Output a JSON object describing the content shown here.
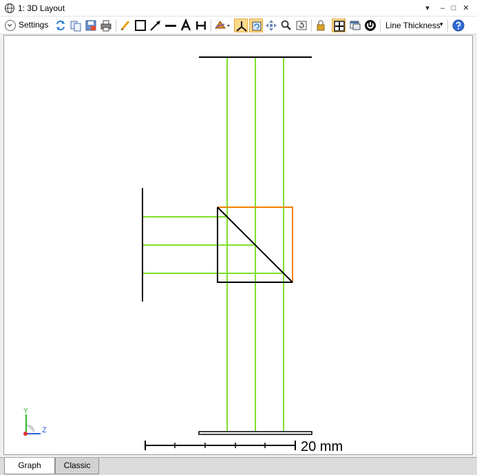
{
  "window": {
    "title": "1: 3D Layout",
    "controls": {
      "dropdown": "▾",
      "minimize": "–",
      "maximize": "□",
      "close": "✕"
    }
  },
  "toolbar": {
    "settings_label": "Settings",
    "line_thickness_label": "Line Thickness",
    "line_thickness_arrow": "▾",
    "icons": [
      "refresh-icon",
      "copy-icon",
      "save-icon",
      "print-icon",
      "pencil-icon",
      "rectangle-icon",
      "arrow-tool-icon",
      "line-tool-icon",
      "text-tool-icon",
      "dimension-tool-icon",
      "rotate-view-icon",
      "axes-icon",
      "refresh-view-icon",
      "pan-icon",
      "zoom-icon",
      "reset-zoom-icon",
      "lock-icon",
      "fit-icon",
      "window-icon",
      "power-icon",
      "help-icon"
    ]
  },
  "canvas": {
    "scale_bar_label": "20 mm",
    "axis_labels": {
      "y": "Y",
      "z": "Z"
    },
    "colors": {
      "ray": "#7ee02a",
      "element": "#000000",
      "highlight": "#f08000",
      "axis_y": "#2db82d",
      "axis_z": "#2b5fd8",
      "axis_x": "#e03030"
    }
  },
  "tabs": [
    {
      "label": "Graph",
      "active": true
    },
    {
      "label": "Classic",
      "active": false
    }
  ]
}
